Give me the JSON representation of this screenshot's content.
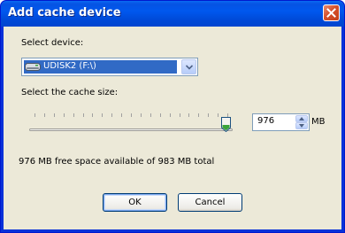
{
  "window": {
    "title": "Add cache device"
  },
  "device": {
    "label": "Select device:",
    "selected": "UDISK2 (F:\\)",
    "icon": "removable-drive-icon"
  },
  "cache": {
    "label": "Select the cache size:",
    "slider_fraction": 0.993,
    "size_value": "976",
    "unit": "MB",
    "info": "976 MB free space available of 983 MB total"
  },
  "buttons": {
    "ok": "OK",
    "cancel": "Cancel"
  },
  "colors": {
    "titlebar": "#0058ee",
    "selection": "#316ac5",
    "face": "#ece9d8",
    "close": "#d6502b"
  }
}
